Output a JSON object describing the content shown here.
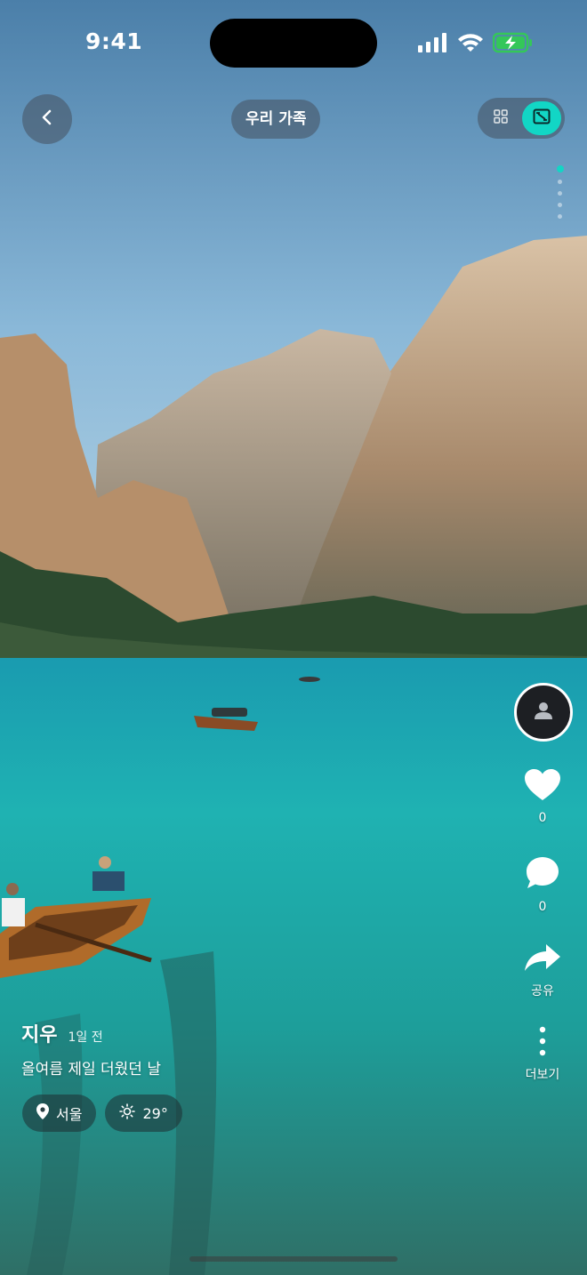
{
  "status_bar": {
    "time": "9:41"
  },
  "header": {
    "album_title": "우리 가족"
  },
  "photo": {
    "pages_total": 5,
    "current_page_index": 0
  },
  "actions": {
    "like_count": "0",
    "comment_count": "0",
    "share_label": "공유",
    "more_label": "더보기"
  },
  "post": {
    "author": "지우",
    "time_ago": "1일 전",
    "caption": "올여름 제일 더웠던 날",
    "location": "서울",
    "temperature": "29°"
  },
  "colors": {
    "accent": "#12d6c5",
    "battery": "#34c759"
  }
}
